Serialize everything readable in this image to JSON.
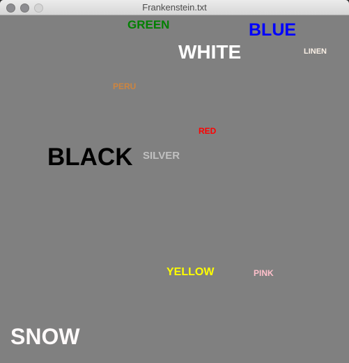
{
  "window": {
    "title": "Frankenstein.txt"
  },
  "words": {
    "green": {
      "text": "GREEN",
      "color": "#008000"
    },
    "blue": {
      "text": "BLUE",
      "color": "#0000FF"
    },
    "white": {
      "text": "WHITE",
      "color": "#FFFFFF"
    },
    "linen": {
      "text": "LINEN",
      "color": "#FAF0E6"
    },
    "peru": {
      "text": "PERU",
      "color": "#CD853F"
    },
    "red": {
      "text": "RED",
      "color": "#FF0000"
    },
    "black": {
      "text": "BLACK",
      "color": "#000000"
    },
    "silver": {
      "text": "SILVER",
      "color": "#C0C0C0"
    },
    "yellow": {
      "text": "YELLOW",
      "color": "#FFFF00"
    },
    "pink": {
      "text": "PINK",
      "color": "#FFC0CB"
    },
    "snow": {
      "text": "SNOW",
      "color": "#FFFAFA"
    }
  }
}
